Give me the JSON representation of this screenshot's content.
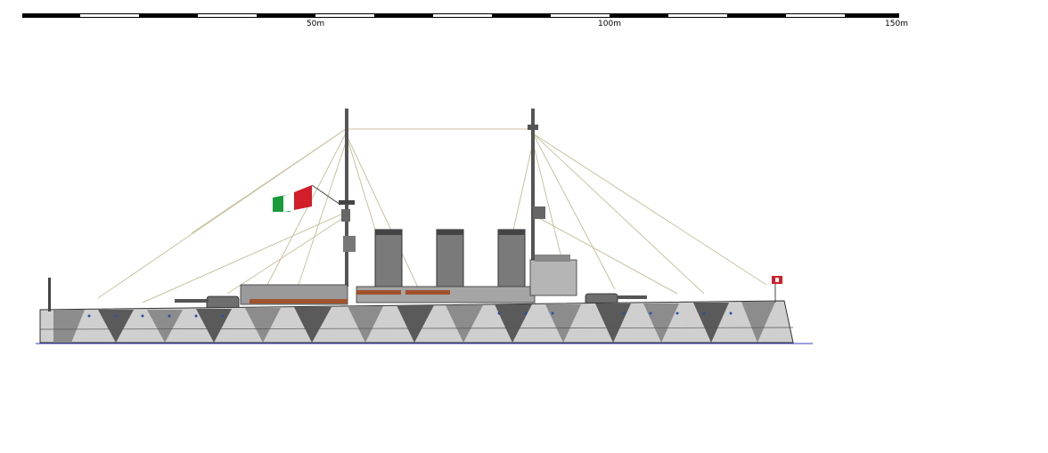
{
  "scale_bar": {
    "labels": [
      "50m",
      "100m",
      "150m"
    ]
  },
  "ship": {
    "camouflage_colors": {
      "light": "#cfcfcf",
      "mid": "#8c8c8c",
      "dark": "#5a5a5a",
      "waterline": "#3d3dc4"
    },
    "flag_colors": [
      "#1a9a3a",
      "#ffffff",
      "#d21d2a"
    ]
  }
}
